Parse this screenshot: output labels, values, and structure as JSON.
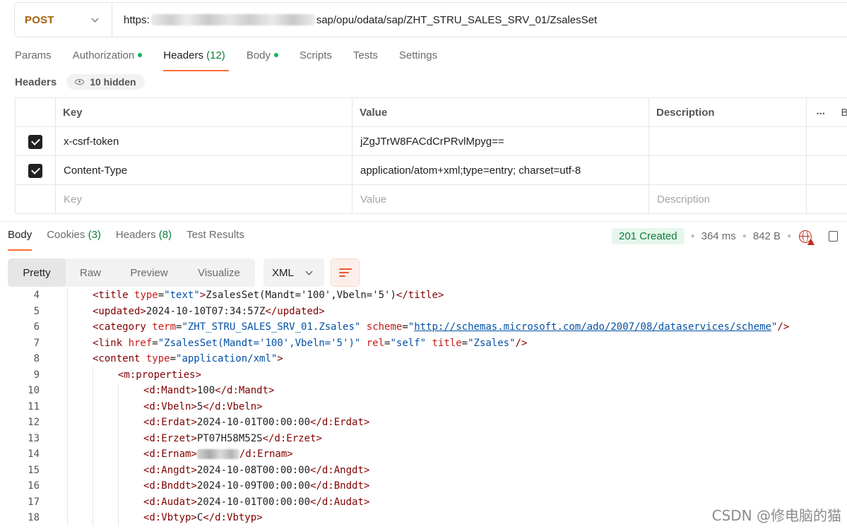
{
  "request": {
    "method": "POST",
    "url_prefix": "https:",
    "url_suffix": "sap/opu/odata/sap/ZHT_STRU_SALES_SRV_01/ZsalesSet"
  },
  "request_tabs": [
    {
      "label": "Params",
      "count": "",
      "dot": false
    },
    {
      "label": "Authorization",
      "count": "",
      "dot": true
    },
    {
      "label": "Headers",
      "count": "(12)",
      "dot": false,
      "active": true
    },
    {
      "label": "Body",
      "count": "",
      "dot": true
    },
    {
      "label": "Scripts",
      "count": "",
      "dot": false
    },
    {
      "label": "Tests",
      "count": "",
      "dot": false
    },
    {
      "label": "Settings",
      "count": "",
      "dot": false
    }
  ],
  "headers_section": {
    "title": "Headers",
    "hidden_label": "10 hidden"
  },
  "headers_table": {
    "columns": {
      "key": "Key",
      "value": "Value",
      "description": "Description",
      "more": "•••",
      "bulk": "Bu"
    },
    "rows": [
      {
        "checked": true,
        "key": "x-csrf-token",
        "value": "jZgJTrW8FACdCrPRvlMpyg==",
        "description": ""
      },
      {
        "checked": true,
        "key": "Content-Type",
        "value": "application/atom+xml;type=entry; charset=utf-8",
        "description": ""
      }
    ],
    "placeholder": {
      "key": "Key",
      "value": "Value",
      "description": "Description"
    }
  },
  "response_tabs": [
    {
      "label": "Body",
      "count": "",
      "active": true
    },
    {
      "label": "Cookies",
      "count": "(3)"
    },
    {
      "label": "Headers",
      "count": "(8)"
    },
    {
      "label": "Test Results",
      "count": ""
    }
  ],
  "response_status": {
    "status": "201 Created",
    "time": "364 ms",
    "size": "842 B",
    "status_color": "#0f7d3e"
  },
  "view_modes": [
    "Pretty",
    "Raw",
    "Preview",
    "Visualize"
  ],
  "active_view_mode": "Pretty",
  "format": "XML",
  "code_lines": [
    {
      "n": "4",
      "indent": 1,
      "html": "<span class=\"tag\">&lt;title </span><span class=\"attr\">type</span>=<span class=\"str\">\"text\"</span><span class=\"tag\">&gt;</span>ZsalesSet(Mandt='100',Vbeln='5')<span class=\"tag\">&lt;/title&gt;</span>"
    },
    {
      "n": "5",
      "indent": 1,
      "html": "<span class=\"tag\">&lt;updated&gt;</span>2024-10-10T07:34:57Z<span class=\"tag\">&lt;/updated&gt;</span>"
    },
    {
      "n": "6",
      "indent": 1,
      "html": "<span class=\"tag\">&lt;category </span><span class=\"attr\">term</span>=<span class=\"str\">\"ZHT_STRU_SALES_SRV_01.Zsales\"</span> <span class=\"attr\">scheme</span>=<span class=\"str\">\"<span class=\"uline\">http://schemas.microsoft.com/ado/2007/08/dataservices/scheme</span>\"</span><span class=\"tag\">/&gt;</span>"
    },
    {
      "n": "7",
      "indent": 1,
      "html": "<span class=\"tag\">&lt;link </span><span class=\"attr\">href</span>=<span class=\"str\">\"ZsalesSet(Mandt='100',Vbeln='5')\"</span> <span class=\"attr\">rel</span>=<span class=\"str\">\"self\"</span> <span class=\"attr\">title</span>=<span class=\"str\">\"Zsales\"</span><span class=\"tag\">/&gt;</span>"
    },
    {
      "n": "8",
      "indent": 1,
      "html": "<span class=\"tag\">&lt;content </span><span class=\"attr\">type</span>=<span class=\"str\">\"application/xml\"</span><span class=\"tag\">&gt;</span>"
    },
    {
      "n": "9",
      "indent": 2,
      "html": "<span class=\"tag\">&lt;m:properties&gt;</span>"
    },
    {
      "n": "10",
      "indent": 3,
      "html": "<span class=\"tag\">&lt;d:Mandt&gt;</span>100<span class=\"tag\">&lt;/d:Mandt&gt;</span>"
    },
    {
      "n": "11",
      "indent": 3,
      "html": "<span class=\"tag\">&lt;d:Vbeln&gt;</span>5<span class=\"tag\">&lt;/d:Vbeln&gt;</span>"
    },
    {
      "n": "12",
      "indent": 3,
      "html": "<span class=\"tag\">&lt;d:Erdat&gt;</span>2024-10-01T00:00:00<span class=\"tag\">&lt;/d:Erdat&gt;</span>"
    },
    {
      "n": "13",
      "indent": 3,
      "html": "<span class=\"tag\">&lt;d:Erzet&gt;</span>PT07H58M52S<span class=\"tag\">&lt;/d:Erzet&gt;</span>"
    },
    {
      "n": "14",
      "indent": 3,
      "html": "<span class=\"tag\">&lt;d:Ernam&gt;</span><span class=\"blurred\"></span><span class=\"tag\">/d:Ernam&gt;</span>"
    },
    {
      "n": "15",
      "indent": 3,
      "html": "<span class=\"tag\">&lt;d:Angdt&gt;</span>2024-10-08T00:00:00<span class=\"tag\">&lt;/d:Angdt&gt;</span>"
    },
    {
      "n": "16",
      "indent": 3,
      "html": "<span class=\"tag\">&lt;d:Bnddt&gt;</span>2024-10-09T00:00:00<span class=\"tag\">&lt;/d:Bnddt&gt;</span>"
    },
    {
      "n": "17",
      "indent": 3,
      "html": "<span class=\"tag\">&lt;d:Audat&gt;</span>2024-10-01T00:00:00<span class=\"tag\">&lt;/d:Audat&gt;</span>"
    },
    {
      "n": "18",
      "indent": 3,
      "html": "<span class=\"tag\">&lt;d:Vbtyp&gt;</span>C<span class=\"tag\">&lt;/d:Vbtyp&gt;</span>"
    }
  ],
  "watermark": "CSDN @修电脑的猫"
}
